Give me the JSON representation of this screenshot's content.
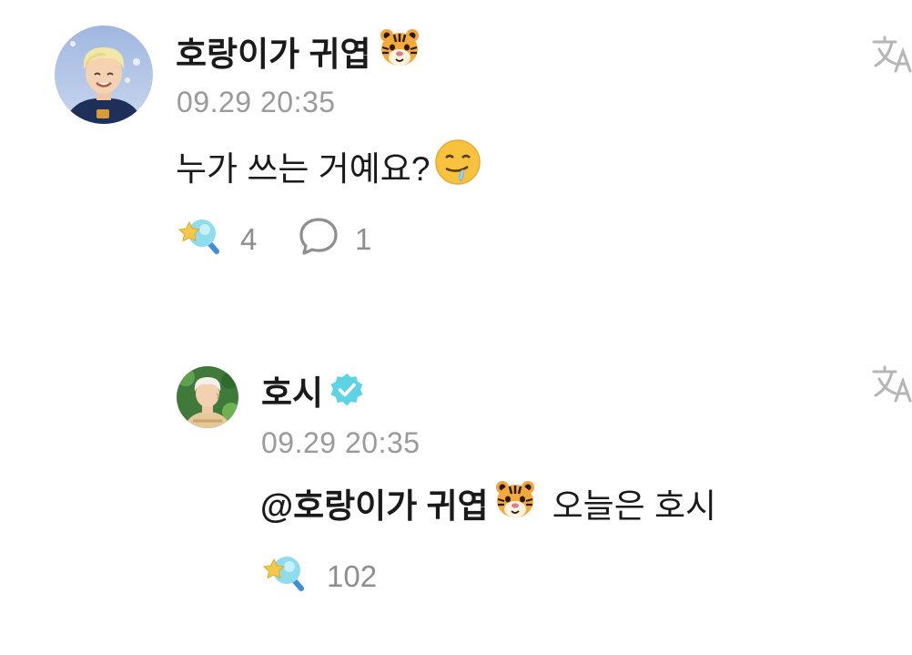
{
  "comments": [
    {
      "username": "호랑이가 귀엽",
      "username_emoji": "tiger-face-emoji",
      "timestamp": "09.29 20:35",
      "text": "누가 쓰는 거예요?",
      "text_emoji": "drooling-face-emoji",
      "like_count": "4",
      "reply_count": "1"
    },
    {
      "username": "호시",
      "verified": true,
      "timestamp": "09.29 20:35",
      "mention": "@호랑이가 귀엽",
      "mention_emoji": "tiger-face-emoji",
      "text": "오늘은 호시",
      "like_count": "102"
    }
  ],
  "icons": {
    "like": "star-wand-icon",
    "reply": "speech-bubble-icon",
    "translate": "translate-icon",
    "verified": "verified-badge-icon"
  },
  "colors": {
    "verified_badge": "#5ed3e3",
    "meta_text": "#9a9a9a",
    "like_wand": "#7dd3e8",
    "like_star": "#f4c94b"
  }
}
